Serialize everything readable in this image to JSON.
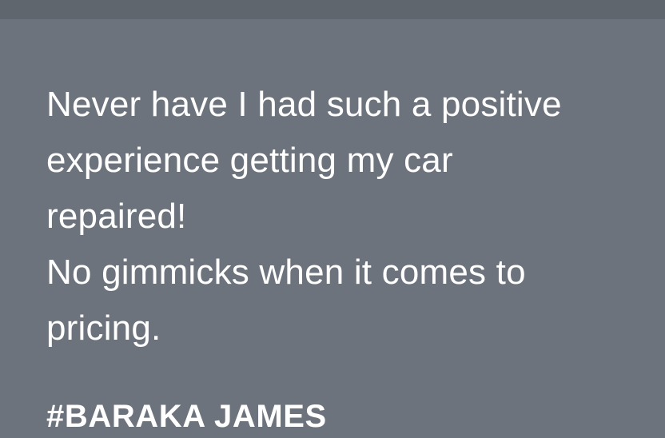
{
  "testimonial": {
    "quote_lines": [
      "Never have I had such a positive",
      "experience getting my car",
      "repaired!",
      "No gimmicks when it comes to",
      "pricing."
    ],
    "author": "#BARAKA JAMES"
  },
  "colors": {
    "background": "#6c737c",
    "top_bar": "#5f666e",
    "text": "#ffffff"
  }
}
